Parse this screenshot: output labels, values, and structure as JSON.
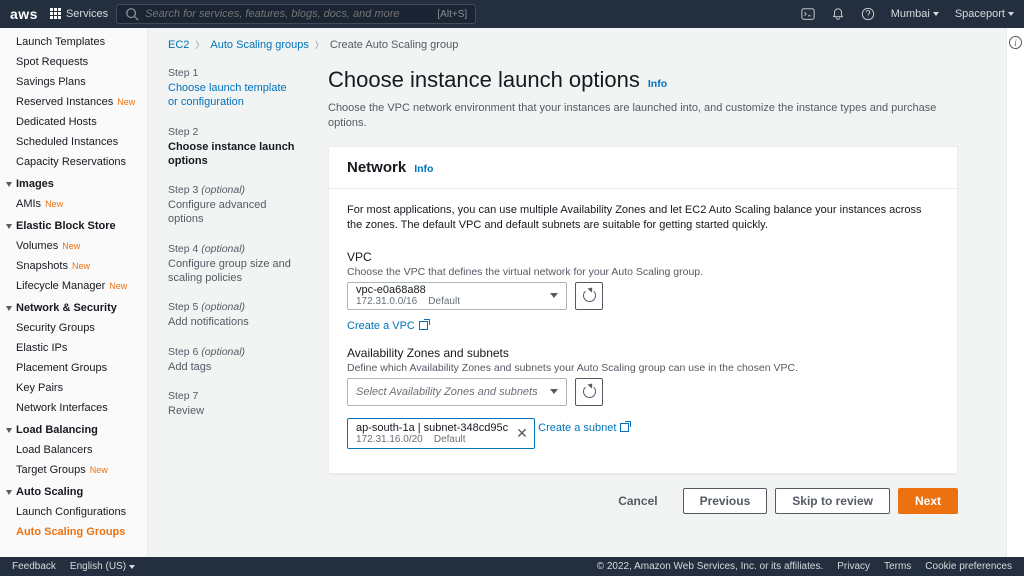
{
  "topnav": {
    "logo": "aws",
    "services": "Services",
    "search_placeholder": "Search for services, features, blogs, docs, and more",
    "search_kbd": "[Alt+S]",
    "region": "Mumbai",
    "account": "Spaceport"
  },
  "sidebar": {
    "groups": [
      {
        "type": "item",
        "label": "Launch Templates"
      },
      {
        "type": "item",
        "label": "Spot Requests"
      },
      {
        "type": "item",
        "label": "Savings Plans"
      },
      {
        "type": "item",
        "label": "Reserved Instances",
        "new": true
      },
      {
        "type": "item",
        "label": "Dedicated Hosts"
      },
      {
        "type": "item",
        "label": "Scheduled Instances"
      },
      {
        "type": "item",
        "label": "Capacity Reservations"
      },
      {
        "type": "head",
        "label": "Images"
      },
      {
        "type": "item",
        "label": "AMIs",
        "new": true
      },
      {
        "type": "head",
        "label": "Elastic Block Store"
      },
      {
        "type": "item",
        "label": "Volumes",
        "new": true
      },
      {
        "type": "item",
        "label": "Snapshots",
        "new": true
      },
      {
        "type": "item",
        "label": "Lifecycle Manager",
        "new": true
      },
      {
        "type": "head",
        "label": "Network & Security"
      },
      {
        "type": "item",
        "label": "Security Groups"
      },
      {
        "type": "item",
        "label": "Elastic IPs"
      },
      {
        "type": "item",
        "label": "Placement Groups"
      },
      {
        "type": "item",
        "label": "Key Pairs"
      },
      {
        "type": "item",
        "label": "Network Interfaces"
      },
      {
        "type": "head",
        "label": "Load Balancing"
      },
      {
        "type": "item",
        "label": "Load Balancers"
      },
      {
        "type": "item",
        "label": "Target Groups",
        "new": true
      },
      {
        "type": "head",
        "label": "Auto Scaling"
      },
      {
        "type": "item",
        "label": "Launch Configurations"
      },
      {
        "type": "item",
        "label": "Auto Scaling Groups",
        "active": true
      }
    ],
    "new_label": "New"
  },
  "breadcrumbs": {
    "a": "EC2",
    "b": "Auto Scaling groups",
    "c": "Create Auto Scaling group"
  },
  "steps": [
    {
      "num": "Step 1",
      "label": "Choose launch template or configuration",
      "link": true
    },
    {
      "num": "Step 2",
      "label": "Choose instance launch options",
      "active": true
    },
    {
      "num": "Step 3 (optional)",
      "label": "Configure advanced options",
      "optional": true
    },
    {
      "num": "Step 4 (optional)",
      "label": "Configure group size and scaling policies",
      "optional": true
    },
    {
      "num": "Step 5 (optional)",
      "label": "Add notifications",
      "optional": true
    },
    {
      "num": "Step 6 (optional)",
      "label": "Add tags",
      "optional": true
    },
    {
      "num": "Step 7",
      "label": "Review"
    }
  ],
  "page": {
    "title": "Choose instance launch options",
    "info": "Info",
    "desc": "Choose the VPC network environment that your instances are launched into, and customize the instance types and purchase options."
  },
  "network": {
    "heading": "Network",
    "info": "Info",
    "intro": "For most applications, you can use multiple Availability Zones and let EC2 Auto Scaling balance your instances across the zones. The default VPC and default subnets are suitable for getting started quickly.",
    "vpc_label": "VPC",
    "vpc_sub": "Choose the VPC that defines the virtual network for your Auto Scaling group.",
    "vpc_value": "vpc-e0a68a88",
    "vpc_cidr": "172.31.0.0/16",
    "vpc_default": "Default",
    "create_vpc": "Create a VPC",
    "az_label": "Availability Zones and subnets",
    "az_sub": "Define which Availability Zones and subnets your Auto Scaling group can use in the chosen VPC.",
    "az_placeholder": "Select Availability Zones and subnets",
    "subnet_value": "ap-south-1a | subnet-348cd95c",
    "subnet_cidr": "172.31.16.0/20",
    "subnet_default": "Default",
    "create_subnet": "Create a subnet"
  },
  "actions": {
    "cancel": "Cancel",
    "previous": "Previous",
    "skip": "Skip to review",
    "next": "Next"
  },
  "footer": {
    "feedback": "Feedback",
    "lang": "English (US)",
    "copyright": "© 2022, Amazon Web Services, Inc. or its affiliates.",
    "privacy": "Privacy",
    "terms": "Terms",
    "cookie": "Cookie preferences"
  }
}
